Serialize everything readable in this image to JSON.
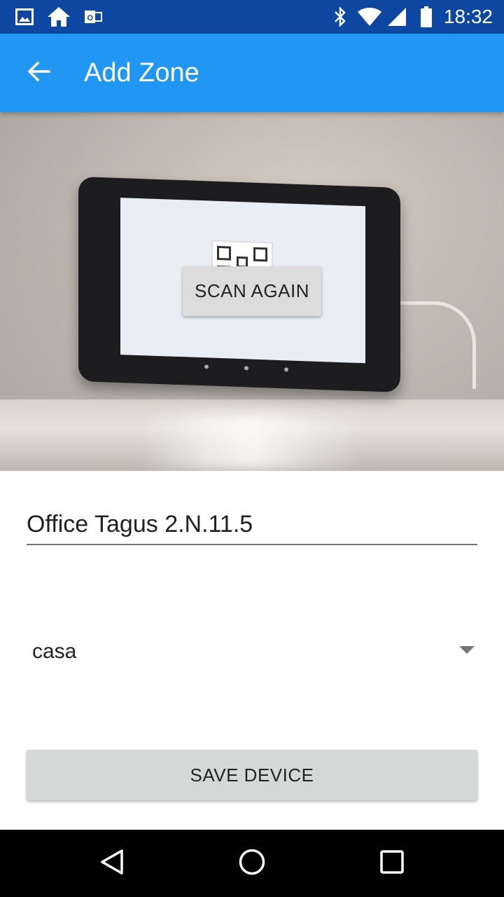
{
  "status_bar": {
    "time": "18:32",
    "left_icons": [
      "image-icon",
      "home-icon",
      "outlook-icon"
    ],
    "right_icons": [
      "bluetooth-icon",
      "wifi-icon",
      "cellular-signal-icon",
      "battery-icon"
    ]
  },
  "app_bar": {
    "title": "Add Zone",
    "back_icon": "arrow-back-icon"
  },
  "camera_preview": {
    "scan_button_label": "SCAN AGAIN"
  },
  "form": {
    "zone_name_value": "Office Tagus 2.N.11.5",
    "location_selected": "casa",
    "save_button_label": "SAVE DEVICE"
  },
  "nav_bar": {
    "icons": [
      "back-triangle-icon",
      "home-circle-icon",
      "recents-square-icon"
    ]
  },
  "colors": {
    "status_bar": "#0d47a1",
    "app_bar": "#2196f3",
    "button": "#d6d7d7",
    "nav_bar": "#000000"
  }
}
